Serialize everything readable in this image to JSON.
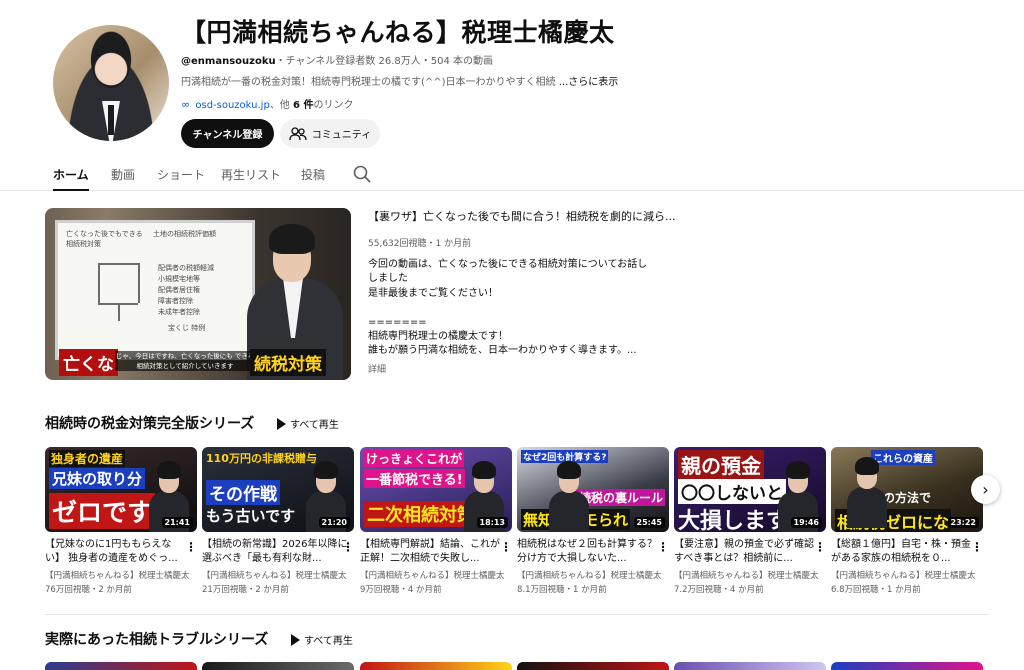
{
  "channel": {
    "title": "【円満相続ちゃんねる】税理士橘慶太",
    "handle": "@enmansouzoku",
    "stats": "・チャンネル登録者数 26.8万人・504 本の動画",
    "description": "円満相続が一番の税金対策！相続専門税理士の橘です(^^)日本一わかりやすく相続",
    "more_label": "...さらに表示",
    "link_text": "osd-souzoku.jp",
    "link_suffix_pre": "、他 ",
    "link_count": "6 件",
    "link_suffix_post": "のリンク",
    "subscribe_label": "チャンネル登録",
    "community_label": "コミュニティ"
  },
  "tabs": [
    {
      "label": "ホーム",
      "active": true
    },
    {
      "label": "動画"
    },
    {
      "label": "ショート"
    },
    {
      "label": "再生リスト"
    },
    {
      "label": "投稿"
    }
  ],
  "featured": {
    "title": "【裏ワザ】亡くなった後でも間に合う！相続税を劇的に減ら...",
    "meta": "55,632回視聴・1 か月前",
    "desc_lines": [
      "今回の動画は、亡くなった後にできる相続対策についてお話し",
      "しました",
      "是非最後までご覧ください！",
      "",
      "=======",
      "相続専門税理士の橘慶太です！",
      "誰もが願う円満な相続を、日本一わかりやすく導きます。..."
    ],
    "more_label": "詳細",
    "thumb_caption_left": "亡くな",
    "thumb_caption_right": "続税対策",
    "thumb_subtitle": "じゃ、今日はですね、亡くなった後にも できる相続対策として紹介していきます",
    "whiteboard": [
      "土地の相続税評価額",
      "亡くなった後でもできる",
      "相続税対策",
      "配偶者の税額軽減",
      "小規模宅地等",
      "配偶者居住権",
      "障害者控除",
      "未成年者控除",
      "宝くじ 特例"
    ]
  },
  "shelf1": {
    "title": "相続時の税金対策完全版シリーズ",
    "play_all": "すべて再生",
    "videos": [
      {
        "thumb_top": "独身者の遺産",
        "thumb_mid": "兄妹の取り分",
        "thumb_big": "ゼロです",
        "duration": "21:41",
        "title": "【兄妹なのに1円ももらえない】 独身者の遺産をめぐっ...",
        "channel": "【円満相続ちゃんねる】税理士橘慶太",
        "meta": "76万回視聴・2 か月前"
      },
      {
        "thumb_top": "110万円の非課税贈与",
        "thumb_mid": "その作戦",
        "thumb_big": "もう古いです",
        "duration": "21:20",
        "title": "【相続の新常識】2026年以降に選ぶべき「最も有利な財...",
        "channel": "【円満相続ちゃんねる】税理士橘慶太",
        "meta": "21万回視聴・2 か月前"
      },
      {
        "thumb_top": "けっきょくこれが",
        "thumb_mid": "一番節税できる!",
        "thumb_big": "二次相続対策5",
        "duration": "18:13",
        "title": "【相続専門解説】結論、これが正解！二次相続で失敗し...",
        "channel": "【円満相続ちゃんねる】税理士橘慶太",
        "meta": "9万回視聴・4 か月前"
      },
      {
        "thumb_top": "なぜ2回も計算する?",
        "thumb_mid": "相続税の裏ルール",
        "thumb_big": "無知はカモられ",
        "duration": "25:45",
        "title": "相続税はなぜ２回も計算する？分け方で大損しないた...",
        "channel": "【円満相続ちゃんねる】税理士橘慶太",
        "meta": "8.1万回視聴・1 か月前"
      },
      {
        "thumb_top": "親の預金",
        "thumb_mid": "〇〇しないと",
        "thumb_big": "大損します",
        "duration": "19:46",
        "title": "【要注意】親の預金で必ず確認すべき事とは？相続前に...",
        "channel": "【円満相続ちゃんねる】税理士橘慶太",
        "meta": "7.2万回視聴・4 か月前"
      },
      {
        "thumb_top": "これらの資産",
        "thumb_mid": "この方法で",
        "thumb_big": "相続税ゼロにな",
        "duration": "23:22",
        "title": "【総額１億円】自宅・株・預金がある家族の相続税を０...",
        "channel": "【円満相続ちゃんねる】税理士橘慶太",
        "meta": "6.8万回視聴・1 か月前"
      }
    ]
  },
  "shelf2": {
    "title": "実際にあった相続トラブルシリーズ",
    "play_all": "すべて再生"
  },
  "colors": {
    "accent": "#065fd4",
    "text": "#0f0f0f",
    "secondary": "#606060",
    "divider": "#e5e5e5"
  },
  "icons": [
    "link-icon",
    "community-icon",
    "search-icon",
    "play-all-icon",
    "more-vert-icon",
    "chevron-right-icon"
  ]
}
